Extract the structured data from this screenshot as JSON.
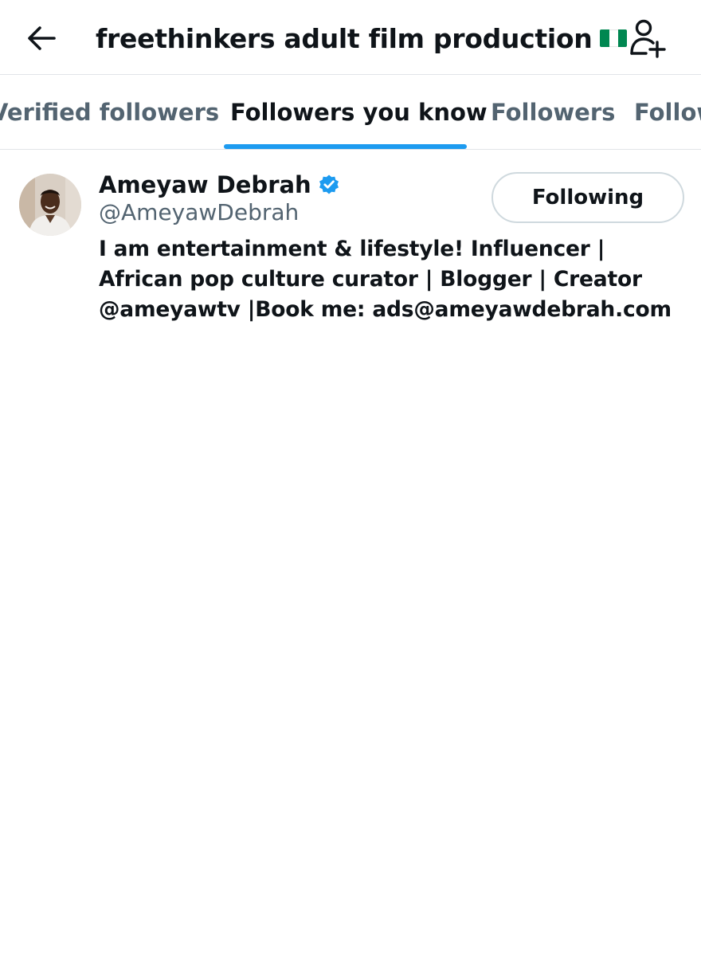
{
  "header": {
    "back_icon": "arrow-left-icon",
    "title": "freethinkers adult film production",
    "title_emoji": "nigeria-flag",
    "add_user_icon": "add-user-icon"
  },
  "tabs": [
    {
      "label": "Verified followers",
      "visible_text": "Verified followers",
      "active": false
    },
    {
      "label": "Followers you know",
      "visible_text": "Followers you know",
      "active": true
    },
    {
      "label": "Followers",
      "visible_text": "Followers",
      "active": false
    },
    {
      "label": "Following",
      "visible_text": "Follow",
      "active": false
    }
  ],
  "users": [
    {
      "display_name": "Ameyaw Debrah",
      "verified": true,
      "handle": "@AmeyawDebrah",
      "follow_button": "Following",
      "bio": "I am entertainment & lifestyle! Influencer | African pop culture curator | Blogger | Creator @ameyawtv |Book me: ads@ameyawdebrah.com"
    }
  ],
  "colors": {
    "accent": "#1d9bf0",
    "text_primary": "#0f1419",
    "text_secondary": "#536471",
    "border": "#e1e4e8",
    "flag_green": "#008751",
    "flag_white": "#ffffff"
  }
}
